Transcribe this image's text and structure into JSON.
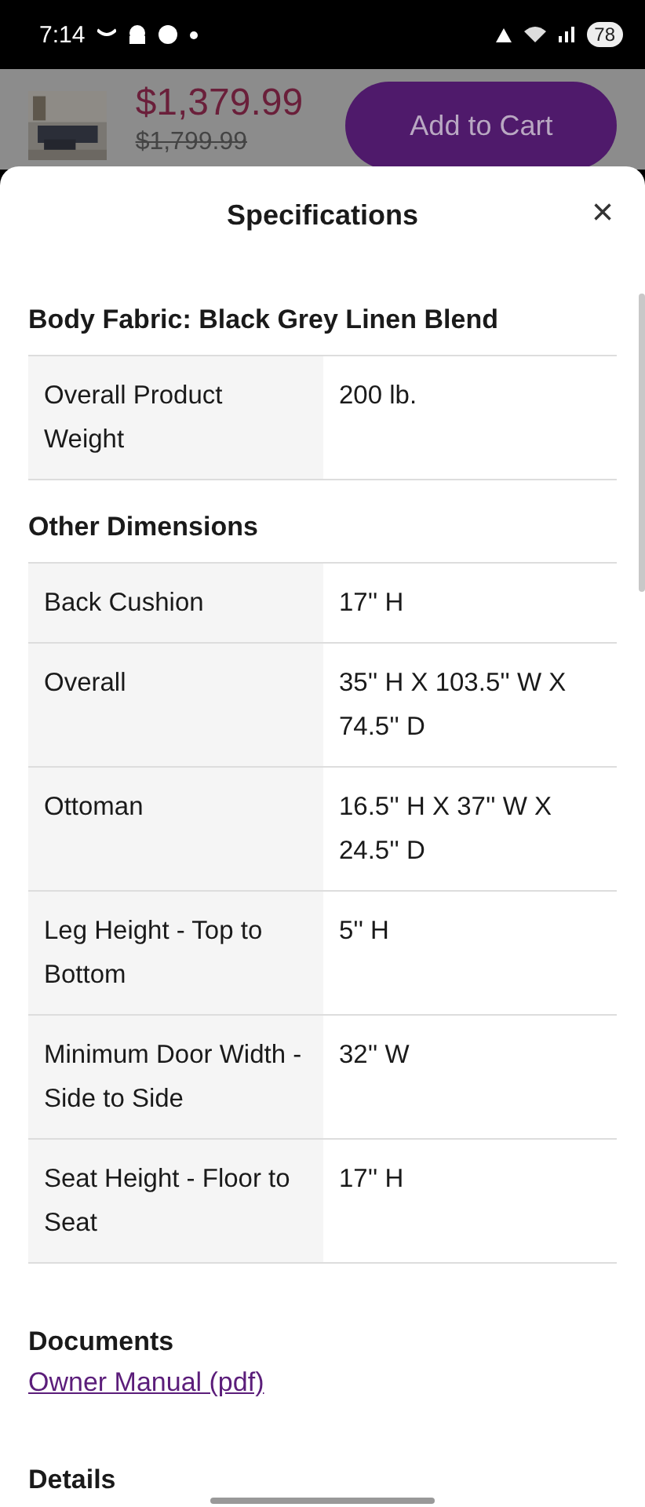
{
  "status_bar": {
    "time": "7:14",
    "battery": "78"
  },
  "product_bar": {
    "price": "$1,379.99",
    "old_price": "$1,799.99",
    "button": "Add to Cart"
  },
  "sheet": {
    "title": "Specifications",
    "close": "×",
    "sections": [
      {
        "heading": "Body Fabric: Black Grey Linen Blend",
        "rows": [
          {
            "label": "Overall Product Weight",
            "value": "200 lb."
          }
        ]
      },
      {
        "heading": "Other Dimensions",
        "rows": [
          {
            "label": "Back Cushion",
            "value": "17'' H"
          },
          {
            "label": "Overall",
            "value": "35'' H X 103.5'' W X 74.5'' D"
          },
          {
            "label": "Ottoman",
            "value": "16.5'' H X 37'' W X 24.5'' D"
          },
          {
            "label": "Leg Height - Top to Bottom",
            "value": "5'' H"
          },
          {
            "label": "Minimum Door Width - Side to Side",
            "value": "32'' W"
          },
          {
            "label": "Seat Height - Floor to Seat",
            "value": "17'' H"
          }
        ]
      }
    ],
    "documents": {
      "heading": "Documents",
      "links": [
        "Owner Manual (pdf)"
      ]
    },
    "next_heading": "Details"
  }
}
